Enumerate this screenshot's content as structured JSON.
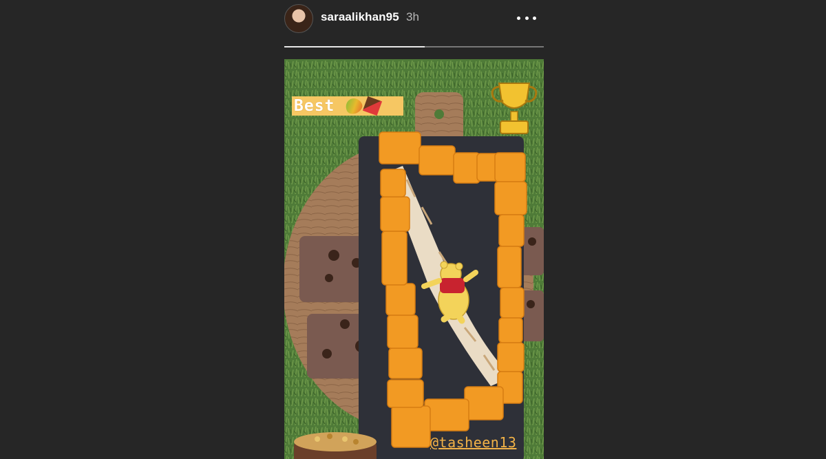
{
  "header": {
    "username": "saraalikhan95",
    "timestamp": "3h",
    "more_icon": "ellipsis-icon"
  },
  "progress": {
    "fraction": 0.54
  },
  "story": {
    "sticker_text": "Best",
    "sticker_emojis": [
      "mango-emoji",
      "chocolate-emoji"
    ],
    "trophy_icon": "trophy-icon",
    "character_sticker": "winnie-the-pooh-sticker",
    "mention": "@tasheen13"
  },
  "colors": {
    "background": "#262626",
    "sticker_bg": "#f6c763",
    "mention": "#f2b247",
    "mango": "#f29a23",
    "cake": "#2e3038"
  }
}
